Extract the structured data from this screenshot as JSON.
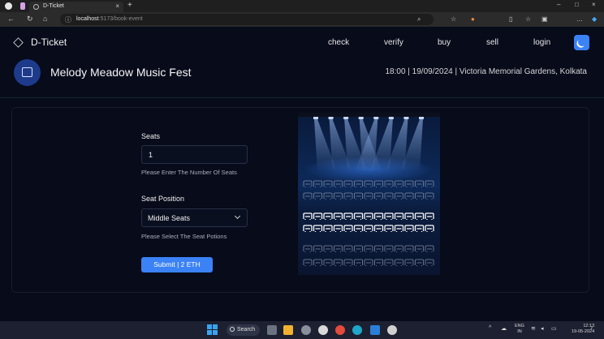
{
  "browser": {
    "tab_title": "D-Ticket",
    "url_host": "localhost",
    "url_path": ":5173/book-event",
    "tab_close_glyph": "×",
    "new_tab_glyph": "+",
    "window_controls": [
      "–",
      "□",
      "×"
    ]
  },
  "nav": {
    "brand": "D-Ticket",
    "links": [
      "check",
      "verify",
      "buy",
      "sell",
      "login"
    ]
  },
  "event": {
    "title": "Melody Meadow Music Fest",
    "meta": "18:00 | 19/09/2024 | Victoria Memorial Gardens, Kolkata"
  },
  "form": {
    "seats_label": "Seats",
    "seats_value": "1",
    "seats_hint": "Please Enter The Number Of Seats",
    "position_label": "Seat Position",
    "position_value": "Middle Seats",
    "position_hint": "Please Select The Seat Potions",
    "submit_label": "Submit | 2 ETH"
  },
  "theater": {
    "seat_rows": [
      {
        "row": 1,
        "state": "dim"
      },
      {
        "row": 2,
        "state": "dim"
      },
      {
        "row": 3,
        "state": "highlighted"
      },
      {
        "row": 4,
        "state": "highlighted"
      },
      {
        "row": 5,
        "state": "dim"
      },
      {
        "row": 6,
        "state": "dim"
      }
    ],
    "seats_per_row": 13,
    "spotlights": 8,
    "colors": {
      "stage": "#0d2a5a",
      "highlight": "#ffffff",
      "dim": "#7f8aa3"
    }
  },
  "taskbar": {
    "search_label": "Search",
    "lang_top": "ENG",
    "lang_bottom": "IN",
    "time": "12:13",
    "date": "19-05-2024"
  },
  "colors": {
    "accent": "#3b82f6",
    "background": "#070b1a"
  }
}
